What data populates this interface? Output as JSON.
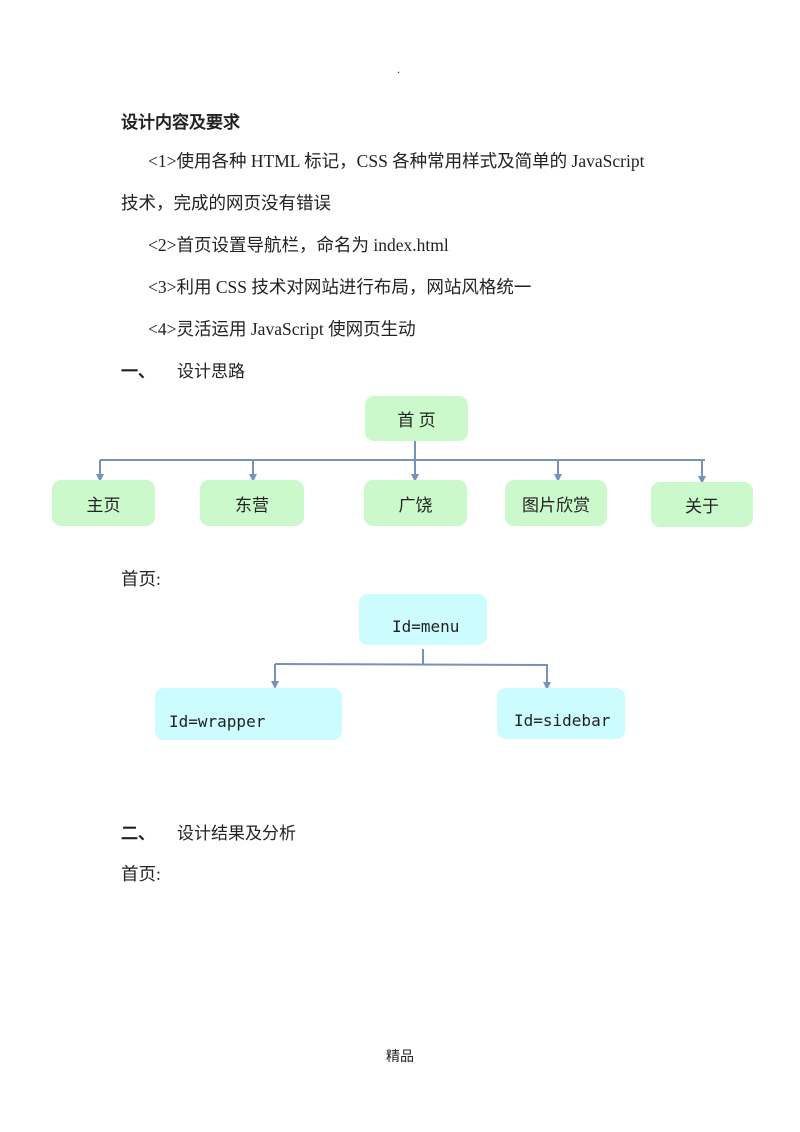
{
  "header_mark": ".",
  "heading": "设计内容及要求",
  "requirements": [
    "<1>使用各种 HTML 标记，CSS 各种常用样式及简单的 JavaScript",
    "技术，完成的网页没有错误",
    "<2>首页设置导航栏，命名为 index.html",
    "<3>利用 CSS 技术对网站进行布局，网站风格统一",
    "<4>灵活运用 JavaScript 使网页生动"
  ],
  "section1": {
    "num": "一、",
    "title": "设计思路"
  },
  "diagram1": {
    "root": "首 页",
    "children": [
      "主页",
      "东营",
      "广饶",
      "图片欣赏",
      "关于"
    ],
    "box_color": "#ccf9cc",
    "line_color": "#7393bb"
  },
  "label_home1": "首页:",
  "diagram2": {
    "root": "Id=menu",
    "children": [
      "Id=wrapper",
      "Id=sidebar"
    ],
    "box_color": "#ccfcfd"
  },
  "section2": {
    "num": "二、",
    "title": "设计结果及分析"
  },
  "label_home2": "首页:",
  "footer": "精品"
}
